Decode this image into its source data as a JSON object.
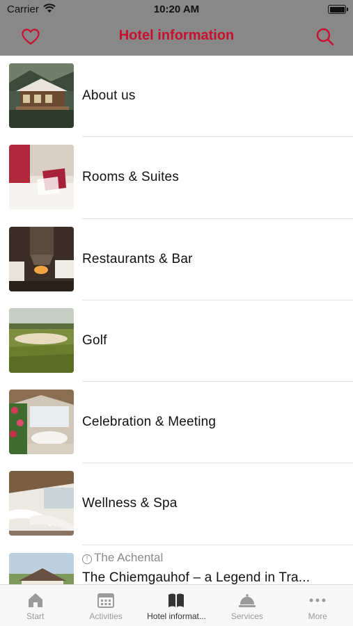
{
  "status_bar": {
    "carrier": "Carrier",
    "time": "10:20 AM"
  },
  "nav": {
    "title": "Hotel information"
  },
  "list": {
    "items": [
      {
        "label": "About us"
      },
      {
        "label": "Rooms & Suites"
      },
      {
        "label": "Restaurants & Bar"
      },
      {
        "label": "Golf"
      },
      {
        "label": "Celebration & Meeting"
      },
      {
        "label": "Wellness & Spa"
      }
    ],
    "news": {
      "category": "The Achental",
      "label": "The Chiemgauhof – a Legend in Tra..."
    }
  },
  "tabs": [
    {
      "label": "Start",
      "icon": "house-icon"
    },
    {
      "label": "Activities",
      "icon": "calendar-icon"
    },
    {
      "label": "Hotel informat...",
      "icon": "book-icon"
    },
    {
      "label": "Services",
      "icon": "service-bell-icon"
    },
    {
      "label": "More",
      "icon": "ellipsis-icon"
    }
  ],
  "colors": {
    "accent": "#c8102e",
    "header": "#888888",
    "tab_active": "#333333",
    "tab_inactive": "#9a9a9a"
  }
}
